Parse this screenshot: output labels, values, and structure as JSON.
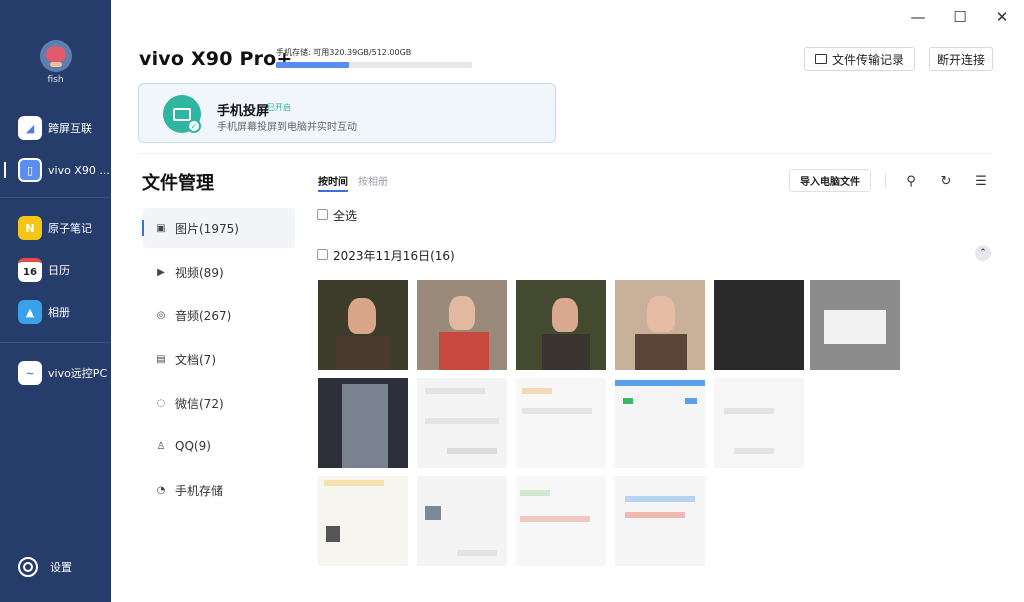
{
  "sidebar": {
    "user_name": "fish",
    "items": [
      {
        "label": "跨屏互联",
        "icon": "cross-screen-icon",
        "color": "#4a7ee8",
        "glyph": "◢"
      },
      {
        "label": "vivo X90 ...",
        "icon": "phone-icon",
        "color": "#5c8df0",
        "glyph": "▯"
      },
      {
        "label": "原子笔记",
        "icon": "notes-icon",
        "color": "#f5c518",
        "glyph": "N"
      },
      {
        "label": "日历",
        "icon": "calendar-icon",
        "color": "#ffffff",
        "glyph": "16"
      },
      {
        "label": "相册",
        "icon": "album-icon",
        "color": "#3aa0e8",
        "glyph": "▲"
      },
      {
        "label": "vivo远控PC",
        "icon": "remote-pc-icon",
        "color": "#3d8ef0",
        "glyph": "~"
      }
    ],
    "settings_label": "设置"
  },
  "window": {
    "minimize": "—",
    "maximize": "☐",
    "close": "✕"
  },
  "header": {
    "device_name": "vivo X90 Pro+",
    "storage_label": "手机存储: 可用320.39GB/512.00GB",
    "storage_used_fraction": 0.374,
    "transfer_log_label": "文件传输记录",
    "disconnect_label": "断开连接"
  },
  "mirror": {
    "title": "手机投屏",
    "status": "已开启",
    "subtitle": "手机屏幕投屏到电脑并实时互动"
  },
  "file_management": {
    "title": "文件管理",
    "categories": [
      {
        "label": "图片(1975)",
        "icon": "image-icon",
        "glyph": "▣"
      },
      {
        "label": "视频(89)",
        "icon": "video-icon",
        "glyph": "▶"
      },
      {
        "label": "音频(267)",
        "icon": "audio-icon",
        "glyph": "◎"
      },
      {
        "label": "文档(7)",
        "icon": "document-icon",
        "glyph": "▤"
      },
      {
        "label": "微信(72)",
        "icon": "wechat-icon",
        "glyph": "◌"
      },
      {
        "label": "QQ(9)",
        "icon": "qq-icon",
        "glyph": "♙"
      },
      {
        "label": "手机存储",
        "icon": "storage-icon",
        "glyph": "◔"
      }
    ],
    "tabs": [
      "按时间",
      "按相册"
    ],
    "import_label": "导入电脑文件",
    "select_all_label": "全选",
    "date_group_label": "2023年11月16日(16)"
  }
}
